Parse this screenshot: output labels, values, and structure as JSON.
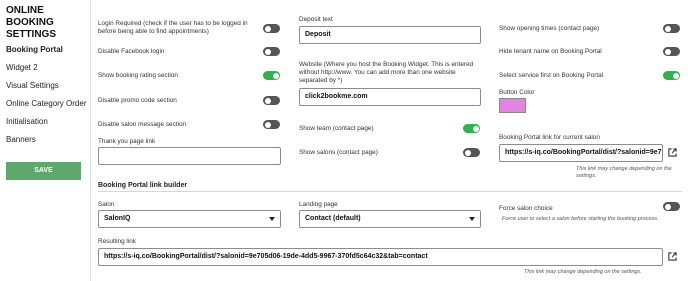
{
  "sidebar": {
    "title_line1": "ONLINE BOOKING",
    "title_line2": "SETTINGS",
    "items": [
      {
        "label": "Booking Portal"
      },
      {
        "label": "Widget 2"
      },
      {
        "label": "Visual Settings"
      },
      {
        "label": "Online Category Order"
      },
      {
        "label": "Initialisation"
      },
      {
        "label": "Banners"
      }
    ],
    "save_label": "SAVE"
  },
  "col1": {
    "login_required_1": "Login Required (check if the user has to be logged in",
    "login_required_2": "before being able to find appointments)",
    "disable_facebook": "Disable Facebook login",
    "show_rating": "Show booking rating section",
    "disable_promo": "Disable promo code section",
    "disable_salon_msg": "Disable salon message section",
    "thank_you_label": "Thank you page link",
    "thank_you_value": ""
  },
  "col2": {
    "deposit_label": "Deposit text",
    "deposit_value": "Deposit",
    "website_label_1": "Website (Where you host the Booking Widget. This is entered",
    "website_label_2": "without http://www. You can add more than one website",
    "website_label_3": "separated by *)",
    "website_value": "click2bookme.com",
    "show_team": "Show team (contact page)",
    "show_salons": "Show salons (contact page)"
  },
  "col3": {
    "show_opening": "Show opening times (contact page)",
    "hide_tenant": "Hide tenant name on Booking Portal",
    "select_service": "Select service first on Booking Portal",
    "button_color_label": "Button Color",
    "button_color": "#e384e1",
    "portal_link_label": "Booking Portal link for current salon",
    "portal_link_value": "https://s-iq.co/BookingPortal/dist/?salonid=9e7",
    "portal_link_note": "This link may change depending on the settings."
  },
  "toggles": {
    "login_required": false,
    "disable_facebook": false,
    "show_rating": true,
    "disable_promo": false,
    "disable_salon_msg": false,
    "show_team": true,
    "show_salons": false,
    "show_opening": false,
    "hide_tenant": false,
    "select_service": true,
    "force_salon": false
  },
  "builder": {
    "heading": "Booking Portal link builder",
    "salon_label": "Salon",
    "salon_value": "SalonIQ",
    "landing_label": "Landing page",
    "landing_value": "Contact (default)",
    "force_label": "Force salon choice",
    "force_note": "Force user to select a salon before starting the booking process.",
    "result_label": "Resulting link",
    "result_value": "https://s-iq.co/BookingPortal/dist/?salonid=9e705d06-19de-4dd5-9967-370fd5c64c32&tab=contact",
    "result_note": "This link may change depending on the settings."
  },
  "colors": {
    "toggle_on": "#2db34a",
    "toggle_off": "#555555",
    "save": "#5ea86e"
  }
}
